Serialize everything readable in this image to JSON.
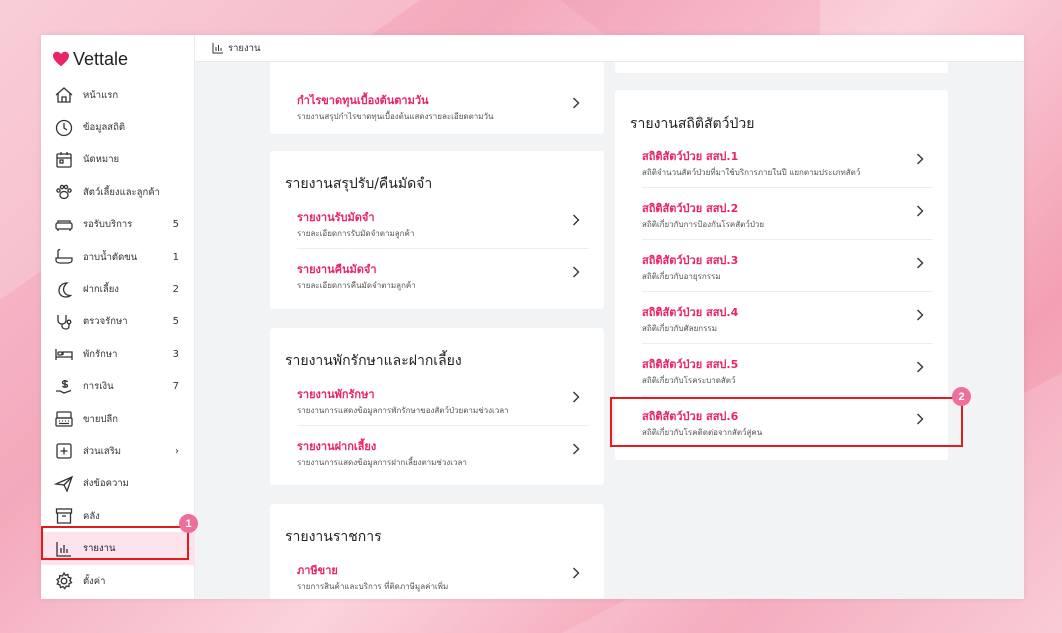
{
  "app": {
    "name": "Vettale"
  },
  "breadcrumb": {
    "title": "รายงาน"
  },
  "sidebar": {
    "items": [
      {
        "label": "หน้าแรก",
        "icon": "home-icon",
        "count": ""
      },
      {
        "label": "ข้อมูลสถิติ",
        "icon": "stats-icon",
        "count": ""
      },
      {
        "label": "นัดหมาย",
        "icon": "calendar-icon",
        "count": ""
      },
      {
        "label": "สัตว์เลี้ยงและลูกค้า",
        "icon": "paw-icon",
        "count": ""
      },
      {
        "label": "รอรับบริการ",
        "icon": "sofa-icon",
        "count": "5"
      },
      {
        "label": "อาบน้ำตัดขน",
        "icon": "bathtub-icon",
        "count": "1"
      },
      {
        "label": "ฝากเลี้ยง",
        "icon": "moon-icon",
        "count": "2"
      },
      {
        "label": "ตรวจรักษา",
        "icon": "stethoscope-icon",
        "count": "5"
      },
      {
        "label": "พักรักษา",
        "icon": "bed-icon",
        "count": "3"
      },
      {
        "label": "การเงิน",
        "icon": "money-icon",
        "count": "7"
      },
      {
        "label": "ขายปลีก",
        "icon": "cash-register-icon",
        "count": ""
      },
      {
        "label": "ส่วนเสริม",
        "icon": "plus-box-icon",
        "count": "›"
      },
      {
        "label": "ส่งข้อความ",
        "icon": "send-icon",
        "count": ""
      },
      {
        "label": "คลัง",
        "icon": "archive-icon",
        "count": ""
      },
      {
        "label": "รายงาน",
        "icon": "report-chart-icon",
        "count": ""
      },
      {
        "label": "ตั้งค่า",
        "icon": "gear-icon",
        "count": ""
      }
    ]
  },
  "cards": {
    "profit": {
      "items": [
        {
          "title": "กำไรขาดทุนเบื้องต้นตามวัน",
          "subtitle": "รายงานสรุปกำไรขาดทุนเบื้องต้นแสดงรายละเอียดตามวัน"
        }
      ]
    },
    "deposit": {
      "title": "รายงานสรุปรับ/คืนมัดจำ",
      "items": [
        {
          "title": "รายงานรับมัดจำ",
          "subtitle": "รายละเอียดการรับมัดจำตามลูกค้า"
        },
        {
          "title": "รายงานคืนมัดจำ",
          "subtitle": "รายละเอียดการคืนมัดจำตามลูกค้า"
        }
      ]
    },
    "boarding": {
      "title": "รายงานพักรักษาและฝากเลี้ยง",
      "items": [
        {
          "title": "รายงานพักรักษา",
          "subtitle": "รายงานการแสดงข้อมูลการพักรักษาของสัตว์ป่วยตามช่วงเวลา"
        },
        {
          "title": "รายงานฝากเลี้ยง",
          "subtitle": "รายงานการแสดงข้อมูลการฝากเลี้ยงตามช่วงเวลา"
        }
      ]
    },
    "government": {
      "title": "รายงานราชการ",
      "items": [
        {
          "title": "ภาษีขาย",
          "subtitle": "รายการสินค้าและบริการ ที่ติดภาษีมูลค่าเพิ่ม"
        }
      ]
    },
    "sick_stats": {
      "title": "รายงานสถิติสัตว์ป่วย",
      "items": [
        {
          "title": "สถิติสัตว์ป่วย สสป.1",
          "subtitle": "สถิติจำนวนสัตว์ป่วยที่มาใช้บริการภายในปี แยกตามประเภทสัตว์"
        },
        {
          "title": "สถิติสัตว์ป่วย สสป.2",
          "subtitle": "สถิติเกี่ยวกับการป้องกันโรคสัตว์ป่วย"
        },
        {
          "title": "สถิติสัตว์ป่วย สสป.3",
          "subtitle": "สถิติเกี่ยวกับอายุรกรรม"
        },
        {
          "title": "สถิติสัตว์ป่วย สสป.4",
          "subtitle": "สถิติเกี่ยวกับศัลยกรรม"
        },
        {
          "title": "สถิติสัตว์ป่วย สสป.5",
          "subtitle": "สถิติเกี่ยวกับโรคระบาดสัตว์"
        },
        {
          "title": "สถิติสัตว์ป่วย สสป.6",
          "subtitle": "สถิติเกี่ยวกับโรคติดต่อจากสัตว์สู่คน"
        }
      ]
    }
  },
  "annotations": {
    "step1": "1",
    "step2": "2"
  },
  "colors": {
    "accent": "#e8246b",
    "highlight": "#e31b1b",
    "badge": "#ee6f99",
    "active_bg": "#fde3ec"
  }
}
